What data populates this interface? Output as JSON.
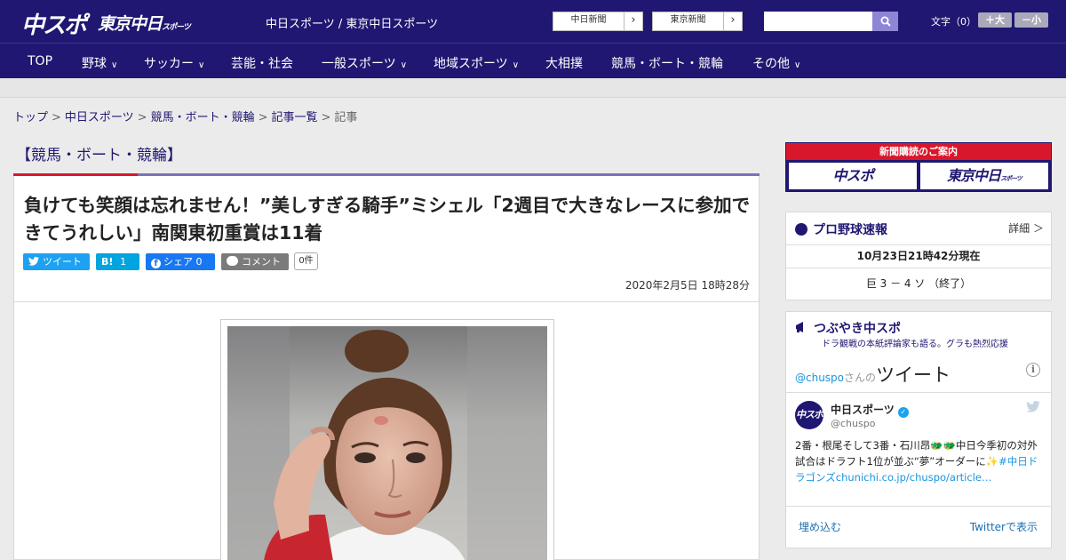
{
  "header": {
    "logo_chuspo": "中スポ",
    "logo_tokyo_main": "東京中日",
    "logo_tokyo_sub": "スポーツ",
    "site_names": "中日スポーツ / 東京中日スポーツ",
    "ext_links": [
      {
        "label": "中日新聞",
        "arrow": "›"
      },
      {
        "label": "東京新聞",
        "arrow": "›"
      }
    ],
    "search": {
      "placeholder": "",
      "icon": "search-icon"
    },
    "font_size_label": "文字（0）",
    "font_larger": "＋大",
    "font_smaller": "－小"
  },
  "nav": {
    "items": [
      {
        "label": "TOP",
        "chevron": ""
      },
      {
        "label": "野球",
        "chevron": "∨"
      },
      {
        "label": "サッカー",
        "chevron": "∨"
      },
      {
        "label": "芸能・社会",
        "chevron": ""
      },
      {
        "label": "一般スポーツ",
        "chevron": "∨"
      },
      {
        "label": "地域スポーツ",
        "chevron": "∨"
      },
      {
        "label": "大相撲",
        "chevron": ""
      },
      {
        "label": "競馬・ボート・競輪",
        "chevron": ""
      },
      {
        "label": "その他",
        "chevron": "∨"
      }
    ]
  },
  "breadcrumb": {
    "items": [
      "トップ",
      "中日スポーツ",
      "競馬・ボート・競輪",
      "記事一覧",
      "記事"
    ],
    "separator": ">"
  },
  "category_title": "【競馬・ボート・競輪】",
  "article": {
    "headline": "負けても笑顔は忘れません！”美しすぎる騎手”ミシェル「2週目で大きなレースに参加できてうれしい」南関東初重賞は11着",
    "share": {
      "tweet": "ツイート",
      "hatena": "B!",
      "hatena_count": "1",
      "facebook": "シェア",
      "facebook_count": "0",
      "comment": "コメント",
      "comment_count": "0件"
    },
    "date": "2020年2月5日 18時28分"
  },
  "sidebar": {
    "subscribe": {
      "title": "新聞購読のご案内",
      "chuspo": "中スポ",
      "tokyo_main": "東京中日",
      "tokyo_sub": "スポーツ"
    },
    "baseball": {
      "title": "プロ野球速報",
      "detail_link": "詳細 ＞",
      "updated": "10月23日21時42分現在",
      "score": "巨 3 － 4 ソ （終了）"
    },
    "tsubuyaki": {
      "title": "つぶやき中スポ",
      "subtitle": "ドラ観戦の本紙評論家も語る。グラも熱烈応援"
    },
    "twitter": {
      "handle_prefix": "@chuspo",
      "handle_suffix": "さんの",
      "heading": "ツイート",
      "info": "i",
      "account_name": "中日スポーツ",
      "account_handle": "@chuspo",
      "avatar_text": "中スポ",
      "tweet_text": "2番・根尾そして3番・石川昂🐲🐲中日今季初の対外試合はドラフト1位が並ぶ“夢”オーダーに✨",
      "tweet_link": "#中日ドラゴンズchunichi.co.jp/chuspo/article…",
      "embed": "埋め込む",
      "view_on_twitter": "Twitterで表示"
    }
  },
  "colors": {
    "brand_navy": "#1f1771",
    "accent_red": "#d9172b",
    "twitter_blue": "#1da1f2",
    "facebook_blue": "#1877f2",
    "hatena_blue": "#00a4de"
  }
}
